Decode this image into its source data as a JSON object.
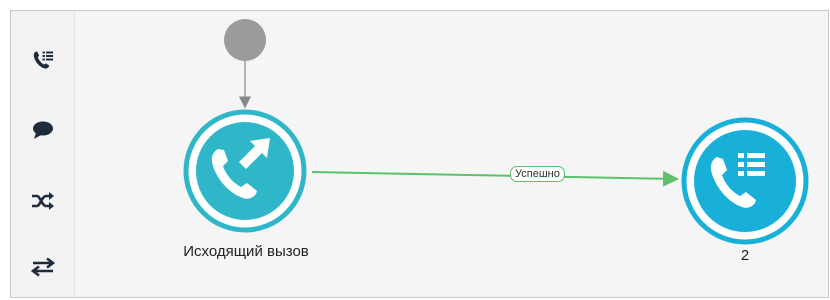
{
  "sidebar": {
    "items": [
      {
        "icon": "call-list-icon"
      },
      {
        "icon": "chat-bubble-icon"
      },
      {
        "icon": "shuffle-icon"
      },
      {
        "icon": "transfer-arrows-icon"
      }
    ]
  },
  "flow": {
    "nodes": [
      {
        "id": "start",
        "icon": "start-node-dot",
        "label": ""
      },
      {
        "id": "outgoing-call",
        "icon": "outgoing-call-icon",
        "label": "Исходящий вызов"
      },
      {
        "id": "call-list-2",
        "icon": "call-list-icon",
        "label": "2"
      }
    ],
    "edges": [
      {
        "from": "start",
        "to": "outgoing-call",
        "label": ""
      },
      {
        "from": "outgoing-call",
        "to": "call-list-2",
        "label": "Успешно"
      }
    ]
  },
  "colors": {
    "node_ring": "#2fb7c9",
    "node_ring_right": "#18b0d8",
    "edge_success": "#5cc16a",
    "start_dot": "#9b9b9b",
    "sidebar_icon": "#1d2b3a"
  }
}
